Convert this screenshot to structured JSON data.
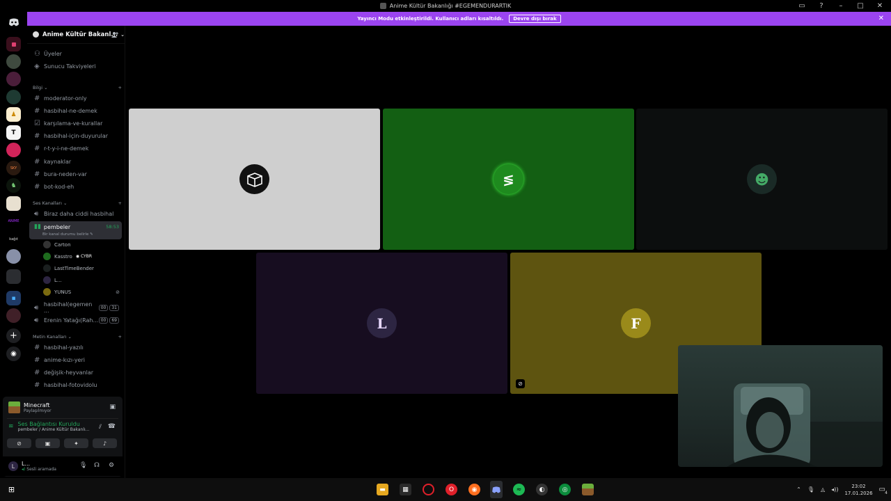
{
  "window": {
    "title": "Anime Kültür Bakanlığı #EGEMENDURARTIK"
  },
  "banner": {
    "text": "Yayıncı Modu etkinleştirildi. Kullanıcı adları kısaltıldı.",
    "button": "Devre dışı bırak"
  },
  "server": {
    "name": "Anime Kültür Bakanl..."
  },
  "top_links": [
    "Üyeler",
    "Sunucu Takviyeleri"
  ],
  "categories": {
    "info": "Bilgi",
    "voice": "Ses Kanalları",
    "text": "Metin Kanalları"
  },
  "info_channels": [
    "moderator-only",
    "hasbihal-ne-demek",
    "karşılama-ve-kurallar",
    "hasbihal-için-duyurular",
    "r-t-y-i-ne-demek",
    "kaynaklar",
    "bura-neden-var",
    "bot-kod-eh"
  ],
  "voice": {
    "channel1": "Biraz daha ciddi hasbihal",
    "active_name": "pembeler",
    "active_time": "58:53",
    "status_hint": "Bir kanal durumu belirle",
    "members": [
      "Carton",
      "Kasstro",
      "LastTimeBender",
      "L...",
      "YUNUS"
    ],
    "member_tag": "CYBR",
    "channel3": "hasbihal(egemen ...",
    "channel3_counts": [
      "00",
      "31"
    ],
    "channel4": "Erenin Yatağı(Rah...",
    "channel4_counts": [
      "00",
      "69"
    ]
  },
  "text_channels": [
    "hasbihal-yazılı",
    "anime-kızı-yeri",
    "değişik-heyvanlar",
    "hasbihal-fotovidolu"
  ],
  "activity": {
    "game": "Minecraft",
    "sub": "Paylaşılmıyor"
  },
  "voice_status": {
    "title": "Ses Bağlantısı Kuruldu",
    "sub": "pembeler / Anime Kültür Bakanlı..."
  },
  "user": {
    "name": "L...",
    "status": "Sesli aramada"
  },
  "taskbar": {
    "time": "23:02",
    "date": "17.01.2026",
    "notif": "4"
  },
  "colors": {
    "banner": "#9b44f0",
    "tile1": "#cfcfcf",
    "tile2": "#135f13",
    "tile3": "#0c0e0e",
    "tile4": "#170d20",
    "tile5": "#5e5410",
    "connected_green": "#23a55a"
  }
}
